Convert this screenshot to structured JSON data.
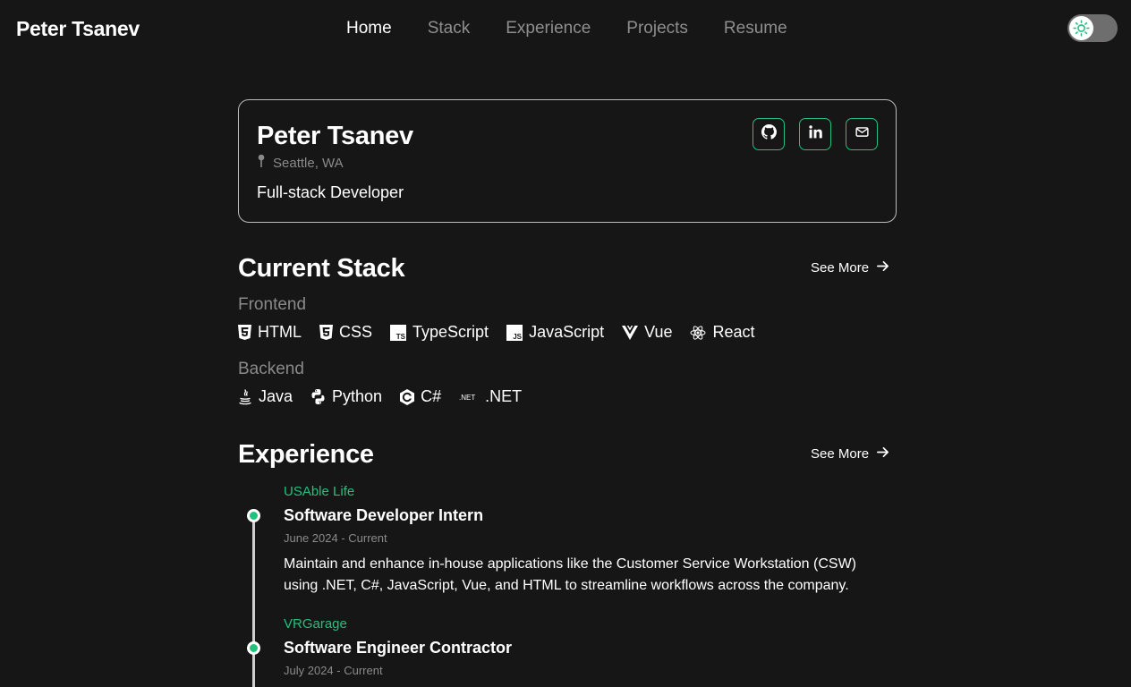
{
  "nav": {
    "brand": "Peter Tsanev",
    "links": [
      "Home",
      "Stack",
      "Experience",
      "Projects",
      "Resume"
    ],
    "theme_toggle_icon": "sun-icon"
  },
  "profile": {
    "name": "Peter Tsanev",
    "location": "Seattle, WA",
    "role": "Full-stack Developer",
    "socials": [
      "github-icon",
      "linkedin-icon",
      "mail-icon"
    ]
  },
  "stack": {
    "title": "Current Stack",
    "see_more": "See More",
    "frontend_label": "Frontend",
    "frontend": [
      "HTML",
      "CSS",
      "TypeScript",
      "JavaScript",
      "Vue",
      "React"
    ],
    "backend_label": "Backend",
    "backend": [
      "Java",
      "Python",
      "C#",
      ".NET"
    ]
  },
  "experience": {
    "title": "Experience",
    "see_more": "See More",
    "items": [
      {
        "company": "USAble Life",
        "title": "Software Developer Intern",
        "date": "June 2024 - Current",
        "description": "Maintain and enhance in-house applications like the Customer Service Workstation (CSW) using .NET, C#, JavaScript, Vue, and HTML to streamline workflows across the company."
      },
      {
        "company": "VRGarage",
        "title": "Software Engineer Contractor",
        "date": "July 2024 - Current"
      }
    ]
  },
  "colors": {
    "accent": "#22c17e",
    "background": "#161616"
  }
}
